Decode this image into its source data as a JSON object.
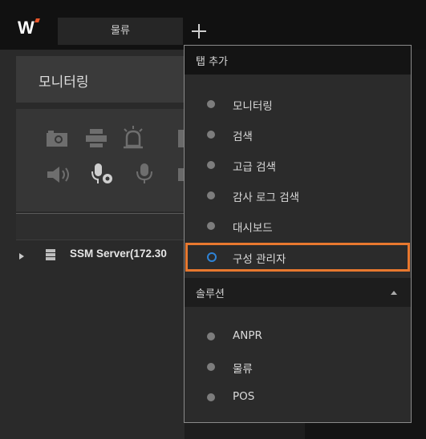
{
  "tabbar": {
    "logo_text": "W",
    "active_tab": "물류",
    "add_tab_icon": "plus-icon"
  },
  "left_panel": {
    "title": "모니터링",
    "tree": {
      "server_label": "SSM Server(172.30"
    },
    "toolbar_icons": [
      "camera-icon",
      "printer-icon",
      "alarm-icon",
      "speaker-icon",
      "microphone-settings-icon",
      "microphone-icon"
    ]
  },
  "dropdown": {
    "header": "탭 추가",
    "items": [
      {
        "label": "모니터링"
      },
      {
        "label": "검색"
      },
      {
        "label": "고급 검색"
      },
      {
        "label": "감사 로그 검색"
      },
      {
        "label": "대시보드"
      },
      {
        "label": "구성 관리자"
      }
    ],
    "section": {
      "label": "솔루션",
      "caret": "caret-up-icon",
      "items": [
        {
          "label": "ANPR"
        },
        {
          "label": "물류"
        },
        {
          "label": "POS"
        }
      ]
    }
  },
  "colors": {
    "highlight": "#e8782f",
    "selected_radio": "#2e83d6",
    "logo_accent": "#e8562a"
  }
}
